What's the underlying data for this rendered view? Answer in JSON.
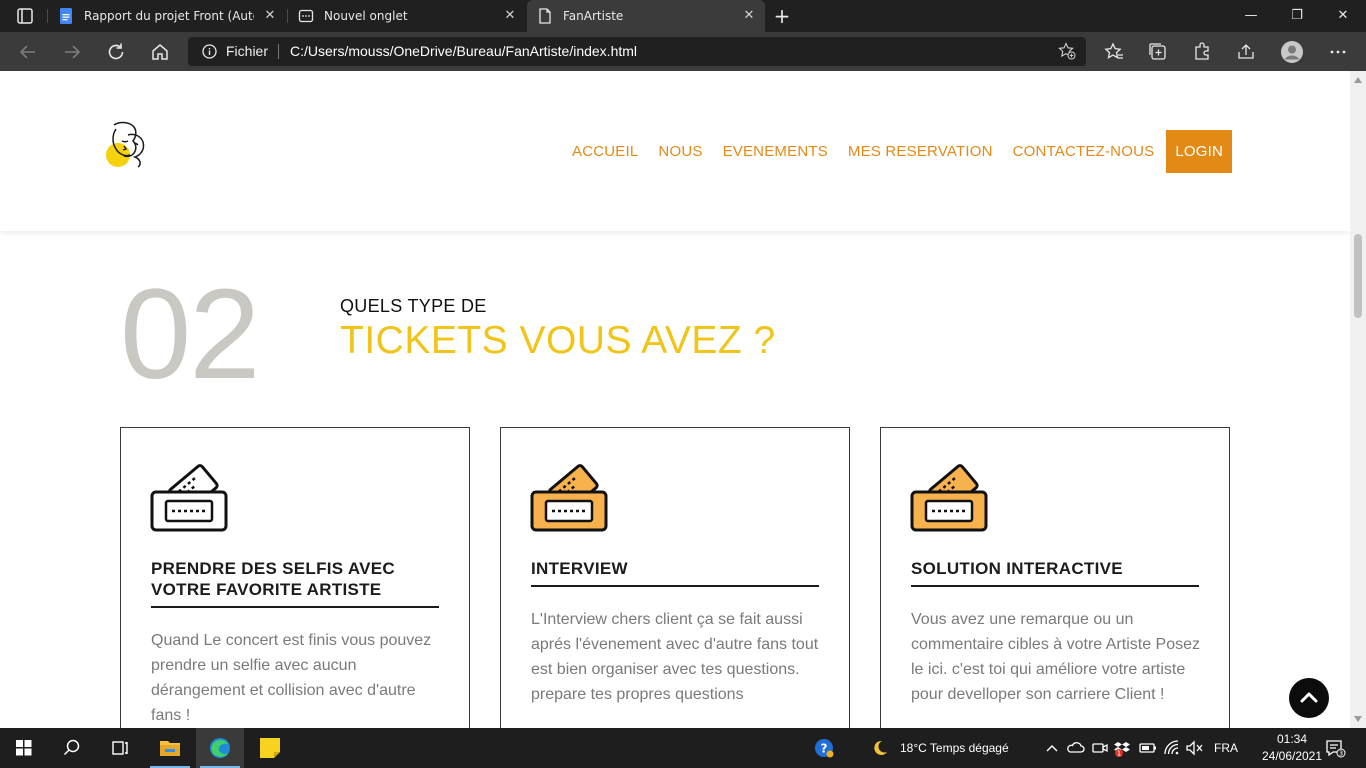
{
  "browser": {
    "tabs": [
      {
        "title": "Rapport du projet Front (AutoRe",
        "icon": "google-docs-icon",
        "active": false
      },
      {
        "title": "Nouvel onglet",
        "icon": "new-tab-icon",
        "active": false
      },
      {
        "title": "FanArtiste",
        "icon": "file-icon",
        "active": true
      }
    ],
    "address": {
      "scheme_label": "Fichier",
      "url": "C:/Users/mouss/OneDrive/Bureau/FanArtiste/index.html"
    }
  },
  "site": {
    "nav": [
      {
        "label": "ACCUEIL"
      },
      {
        "label": "NOUS"
      },
      {
        "label": "EVENEMENTS"
      },
      {
        "label": "MES RESERVATION"
      },
      {
        "label": "CONTACTEZ-NOUS"
      },
      {
        "label": "LOGIN"
      }
    ],
    "section": {
      "number": "02",
      "subtitle": "QUELS TYPE DE",
      "title": "TICKETS VOUS AVEZ ?"
    },
    "cards": [
      {
        "title": "PRENDRE DES SELFIS AVEC VOTRE FAVORITE ARTISTE",
        "body": "Quand Le concert est finis vous pouvez prendre un selfie avec aucun dérangement et collision avec d'autre fans !",
        "icon": "ticket-icon",
        "icon_variant": "white"
      },
      {
        "title": "INTERVIEW",
        "body_lines": [
          "L'Interview chers client ça se fait aussi aprés l'évenement avec d'autre fans tout est bien organiser avec tes questions.",
          "prepare tes propres questions"
        ],
        "icon": "ticket-icon",
        "icon_variant": "orange"
      },
      {
        "title": "SOLUTION INTERACTIVE",
        "body": "Vous avez une remarque ou un commentaire cibles à votre Artiste Posez le ici. c'est toi qui améliore votre artiste pour develloper son carriere Client !",
        "icon": "ticket-icon",
        "icon_variant": "orange"
      }
    ],
    "colors": {
      "accent_orange": "#e38a16",
      "title_yellow": "#f0c419",
      "number_gray": "#c9c8c3"
    }
  },
  "taskbar": {
    "weather": "18°C  Temps dégagé",
    "language": "FRA",
    "time": "01:34",
    "date": "24/06/2021",
    "notification_count": "3",
    "mail_badge": "1"
  }
}
